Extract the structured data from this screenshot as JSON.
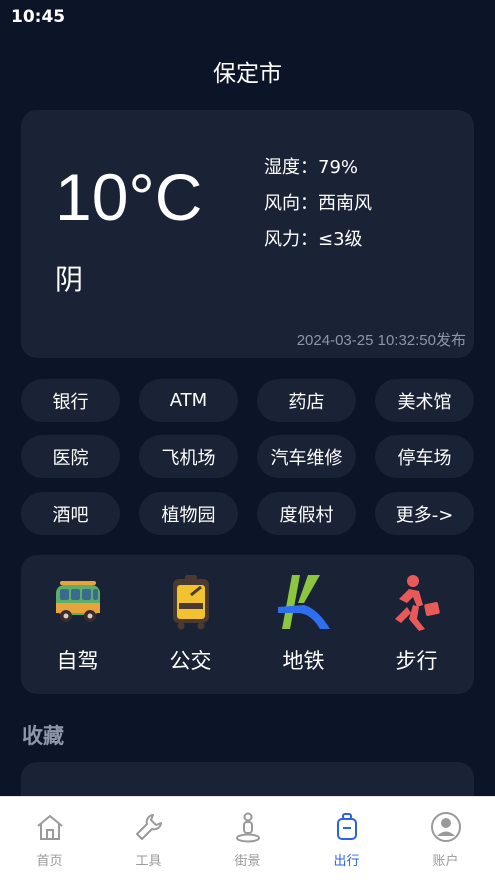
{
  "status_bar": {
    "time": "10:45"
  },
  "header": {
    "city": "保定市"
  },
  "weather": {
    "temperature": "10°C",
    "condition": "阴",
    "humidity": "湿度：79%",
    "wind_direction": "风向：西南风",
    "wind_force": "风力：≤3级",
    "published": "2024-03-25 10:32:50发布"
  },
  "categories": [
    "银行",
    "ATM",
    "药店",
    "美术馆",
    "医院",
    "飞机场",
    "汽车维修",
    "停车场",
    "酒吧",
    "植物园",
    "度假村",
    "更多->"
  ],
  "transport": {
    "modes": [
      {
        "label": "自驾",
        "icon": "van-icon"
      },
      {
        "label": "公交",
        "icon": "bus-icon"
      },
      {
        "label": "地铁",
        "icon": "metro-icon"
      },
      {
        "label": "步行",
        "icon": "walking-icon"
      }
    ]
  },
  "favorites": {
    "title": "收藏"
  },
  "tabbar": {
    "active": "出行",
    "tabs": [
      {
        "label": "首页",
        "icon": "home-icon"
      },
      {
        "label": "工具",
        "icon": "wrench-icon"
      },
      {
        "label": "街景",
        "icon": "street-view-icon"
      },
      {
        "label": "出行",
        "icon": "luggage-icon"
      },
      {
        "label": "账户",
        "icon": "account-icon"
      }
    ]
  },
  "colors": {
    "background": "#0c1428",
    "card": "#1a2336",
    "accent": "#2b62ea",
    "muted_text": "#8d95a6"
  }
}
